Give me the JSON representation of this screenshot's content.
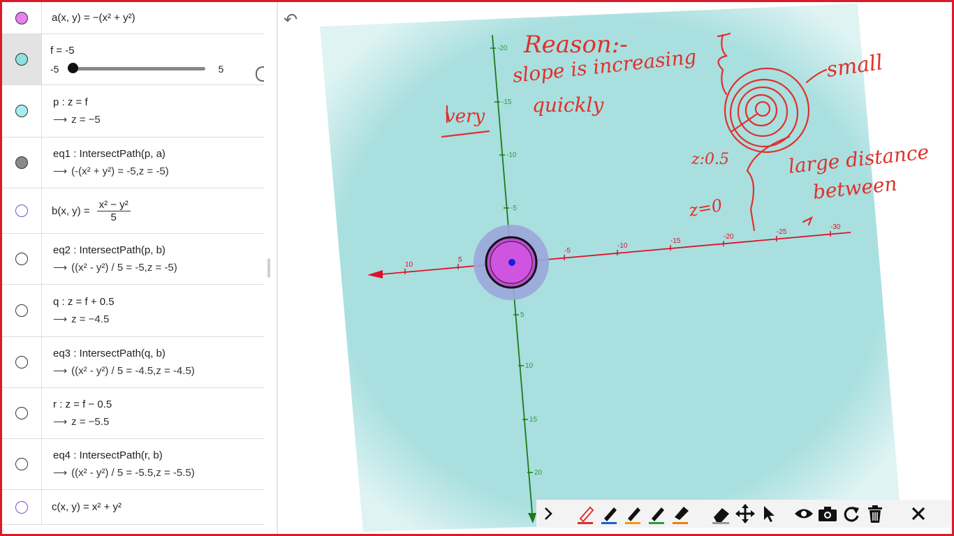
{
  "algebra": {
    "rows": [
      {
        "marble_color": "#e880f0",
        "def": "a(x, y)  =  −(x² + y²)"
      },
      {
        "marble_color": "#8ee0de",
        "def": "f = -5",
        "slider": {
          "min": "-5",
          "max": "5",
          "value": -5
        }
      },
      {
        "marble_color": "#a6eeee",
        "def": "p : z  =  f",
        "out": "z  =  −5"
      },
      {
        "marble_color": "#8a8a8a",
        "def": "eq1 : IntersectPath(p, a)",
        "out": "(-(x² + y²) = -5,z = -5)"
      },
      {
        "marble_color": "#ffffff",
        "marble_border": "#7a4fcf",
        "def_prefix": "b(x, y)  =",
        "frac_num": "x² − y²",
        "frac_den": "5"
      },
      {
        "marble_color": "#ffffff",
        "def": "eq2 : IntersectPath(p, b)",
        "out": "((x² - y²) / 5 = -5,z = -5)"
      },
      {
        "marble_color": "#ffffff",
        "def": "q : z  =  f + 0.5",
        "out": "z  =  −4.5"
      },
      {
        "marble_color": "#ffffff",
        "def": "eq3 : IntersectPath(q, b)",
        "out": "((x² - y²) / 5 = -4.5,z = -4.5)"
      },
      {
        "marble_color": "#ffffff",
        "def": "r : z  =  f − 0.5",
        "out": "z  =  −5.5"
      },
      {
        "marble_color": "#ffffff",
        "def": "eq4 : IntersectPath(r, b)",
        "out": "((x² - y²) / 5 = -5.5,z = -5.5)"
      },
      {
        "marble_color": "#ffffff",
        "marble_border": "#7a4fcf",
        "def": "c(x, y)  =  x² + y²"
      }
    ],
    "arrow": "⟶"
  },
  "graphics": {
    "undo_icon": "↶",
    "y_ticks": [
      "-20",
      "-15",
      "-10",
      "-5",
      "5",
      "10",
      "15",
      "20"
    ],
    "x_ticks": [
      "10",
      "5",
      "-5",
      "-10",
      "-15",
      "-20",
      "-25",
      "-30"
    ],
    "annotations": [
      "Reason:-",
      "slope is increasing",
      "very",
      "quickly",
      "small",
      "z:0.5",
      "large distance",
      "between",
      "z=0"
    ]
  },
  "toolbar": {
    "icons": [
      "chevron-right-icon",
      "pen-red-icon",
      "pen-blue-icon",
      "pen-orange-icon",
      "pen-green-icon",
      "highlighter-icon",
      "eraser-icon",
      "move-icon",
      "pointer-icon",
      "eye-icon",
      "camera-icon",
      "redo-icon",
      "trash-icon",
      "close-icon"
    ]
  },
  "colors": {
    "frame": "#d81b2b",
    "plane": "#a9dfdf",
    "y_axis": "#1b7a1b",
    "x_axis": "#e0102a",
    "ink": "#e0302a"
  }
}
